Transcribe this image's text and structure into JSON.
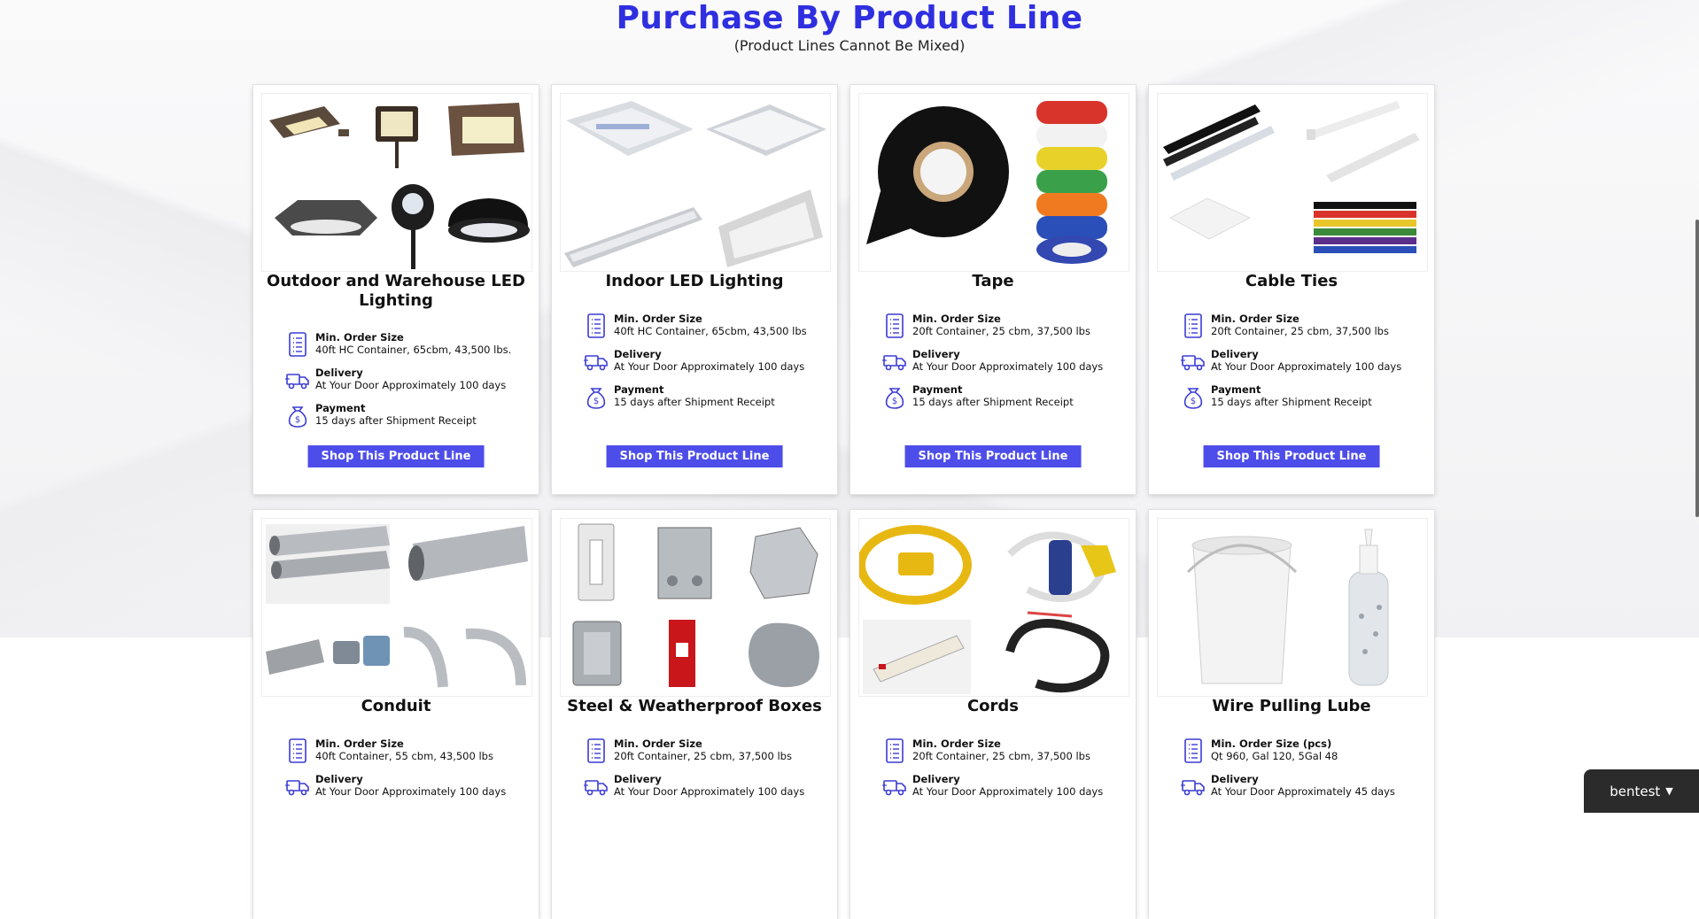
{
  "header": {
    "title": "Purchase By Product Line",
    "subtitle": "(Product Lines Cannot Be Mixed)"
  },
  "colors": {
    "accent": "#2f2fe0",
    "button": "#4d4dea",
    "icon": "#3b3bd6"
  },
  "icons": {
    "order": "document-list-icon",
    "delivery": "truck-icon",
    "payment": "money-bag-icon"
  },
  "products": [
    {
      "title": "Outdoor and Warehouse LED Lighting",
      "min_order_label": "Min. Order Size",
      "min_order_value": "40ft HC Container, 65cbm, 43,500 lbs.",
      "delivery_label": "Delivery",
      "delivery_value": "At Your Door Approximately 100 days",
      "payment_label": "Payment",
      "payment_value": "15 days after Shipment Receipt",
      "button": "Shop This Product Line",
      "image": "outdoor-led-fixtures"
    },
    {
      "title": "Indoor LED Lighting",
      "min_order_label": "Min. Order Size",
      "min_order_value": "40ft HC Container, 65cbm, 43,500 lbs",
      "delivery_label": "Delivery",
      "delivery_value": "At Your Door Approximately 100 days",
      "payment_label": "Payment",
      "payment_value": "15 days after Shipment Receipt",
      "button": "Shop This Product Line",
      "image": "indoor-led-panels"
    },
    {
      "title": "Tape",
      "min_order_label": "Min. Order Size",
      "min_order_value": "20ft Container, 25 cbm, 37,500 lbs",
      "delivery_label": "Delivery",
      "delivery_value": "At Your Door Approximately 100 days",
      "payment_label": "Payment",
      "payment_value": "15 days after Shipment Receipt",
      "button": "Shop This Product Line",
      "image": "electrical-tape"
    },
    {
      "title": "Cable Ties",
      "min_order_label": "Min. Order Size",
      "min_order_value": "20ft Container, 25 cbm, 37,500 lbs",
      "delivery_label": "Delivery",
      "delivery_value": "At Your Door Approximately 100 days",
      "payment_label": "Payment",
      "payment_value": "15 days after Shipment Receipt",
      "button": "Shop This Product Line",
      "image": "cable-ties"
    },
    {
      "title": "Conduit",
      "min_order_label": "Min. Order Size",
      "min_order_value": "40ft Container, 55 cbm, 43,500 lbs",
      "delivery_label": "Delivery",
      "delivery_value": "At Your Door Approximately 100 days",
      "payment_label": "",
      "payment_value": "",
      "button": "",
      "image": "conduit-pipes"
    },
    {
      "title": "Steel & Weatherproof Boxes",
      "min_order_label": "Min. Order Size",
      "min_order_value": "20ft Container, 25 cbm, 37,500 lbs",
      "delivery_label": "Delivery",
      "delivery_value": "At Your Door Approximately 100 days",
      "payment_label": "",
      "payment_value": "",
      "button": "",
      "image": "electrical-boxes"
    },
    {
      "title": "Cords",
      "min_order_label": "Min. Order Size",
      "min_order_value": "20ft Container, 25 cbm, 37,500 lbs",
      "delivery_label": "Delivery",
      "delivery_value": "At Your Door Approximately 100 days",
      "payment_label": "",
      "payment_value": "",
      "button": "",
      "image": "extension-cords"
    },
    {
      "title": "Wire Pulling Lube",
      "min_order_label": "Min. Order Size (pcs)",
      "min_order_value": "Qt 960, Gal 120, 5Gal 48",
      "delivery_label": "Delivery",
      "delivery_value": "At Your Door Approximately 45 days",
      "payment_label": "",
      "payment_value": "",
      "button": "",
      "image": "lube-bucket"
    }
  ],
  "user": {
    "name": "bentest"
  }
}
